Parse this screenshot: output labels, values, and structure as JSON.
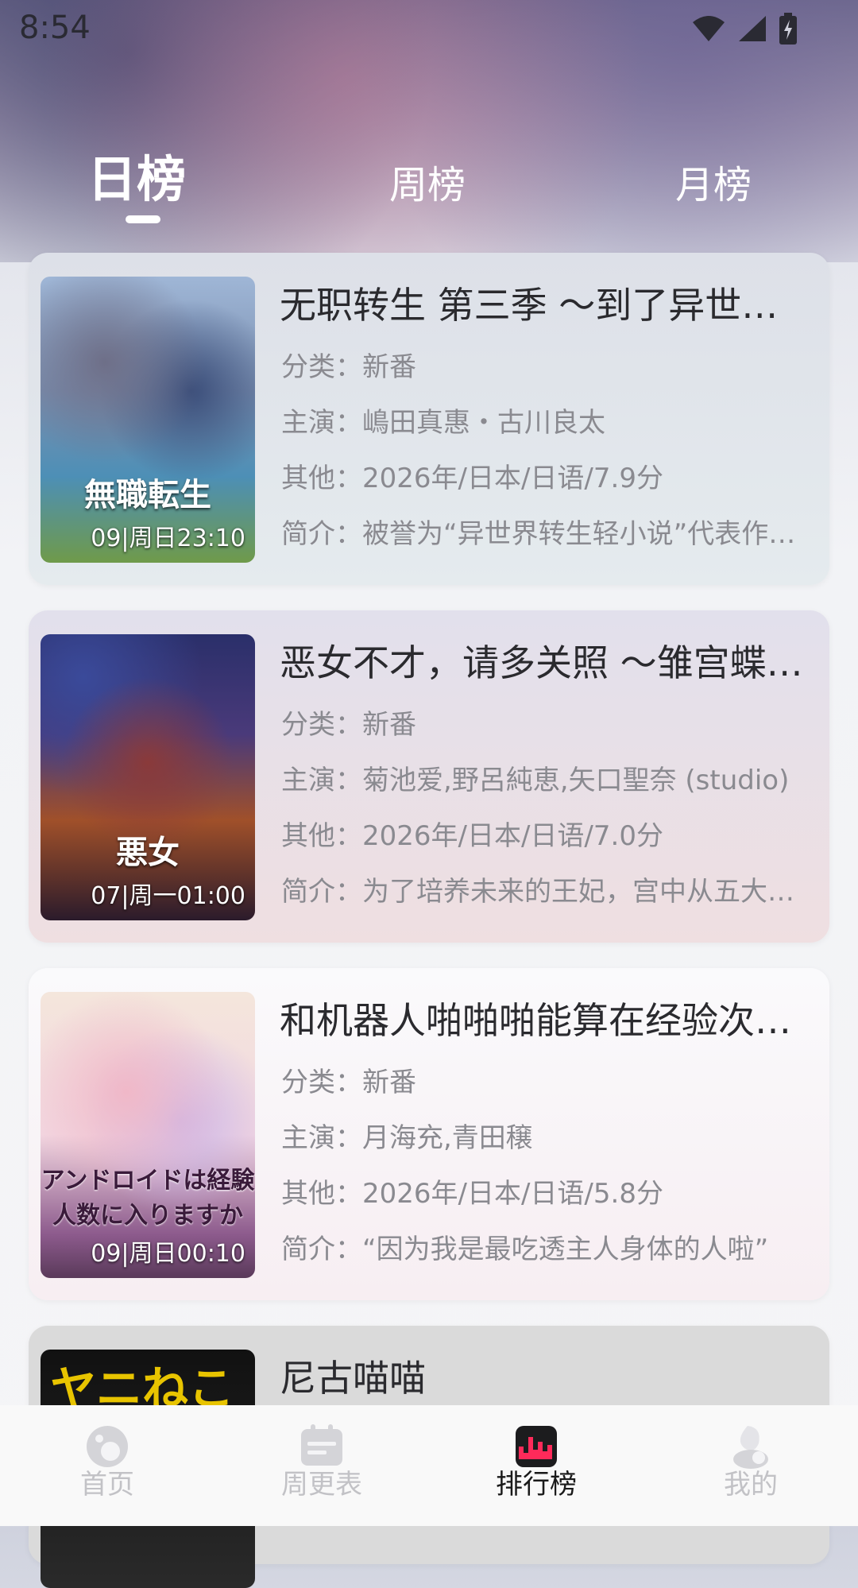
{
  "status_bar": {
    "time": "8:54"
  },
  "tabs": {
    "day": "日榜",
    "week": "周榜",
    "month": "月榜"
  },
  "cards": [
    {
      "title": "无职转生 第三季 ～到了异世界就拿出真本事～",
      "category": "分类：新番",
      "cast": "主演：嶋田真惠・古川良太",
      "other": "其他：2026年/日本/日语/7.9分",
      "intro": "简介：被誉为“异世界转生轻小说”代表作品的《无职转生》",
      "time": "09|周日23:10",
      "poster_art": "無職転生"
    },
    {
      "title": "恶女不才，请多关照 ～雏宫蝶鸣物语～",
      "category": "分类：新番",
      "cast": "主演：菊池爱,野呂純恵,矢口聖奈 (studio)",
      "other": "其他：2026年/日本/日语/7.0分",
      "intro": "简介：为了培养未来的王妃，宫中从五大家族中选出了",
      "time": "07|周一01:00",
      "poster_art": "悪女"
    },
    {
      "title": "和机器人啪啪啪能算在经验次数里吗？？",
      "category": "分类：新番",
      "cast": "主演：月海充,青田穣",
      "other": "其他：2026年/日本/日语/5.8分",
      "intro": "简介：“因为我是最吃透主人身体的人啦”",
      "time": "09|周日00:10",
      "poster_art": "アンドロイドは経験人数に入りますか"
    },
    {
      "title": "尼古喵喵",
      "poster_art": "ヤニねこ"
    }
  ],
  "bottom_nav": {
    "home": "首页",
    "schedule": "周更表",
    "ranking": "排行榜",
    "mine": "我的"
  }
}
